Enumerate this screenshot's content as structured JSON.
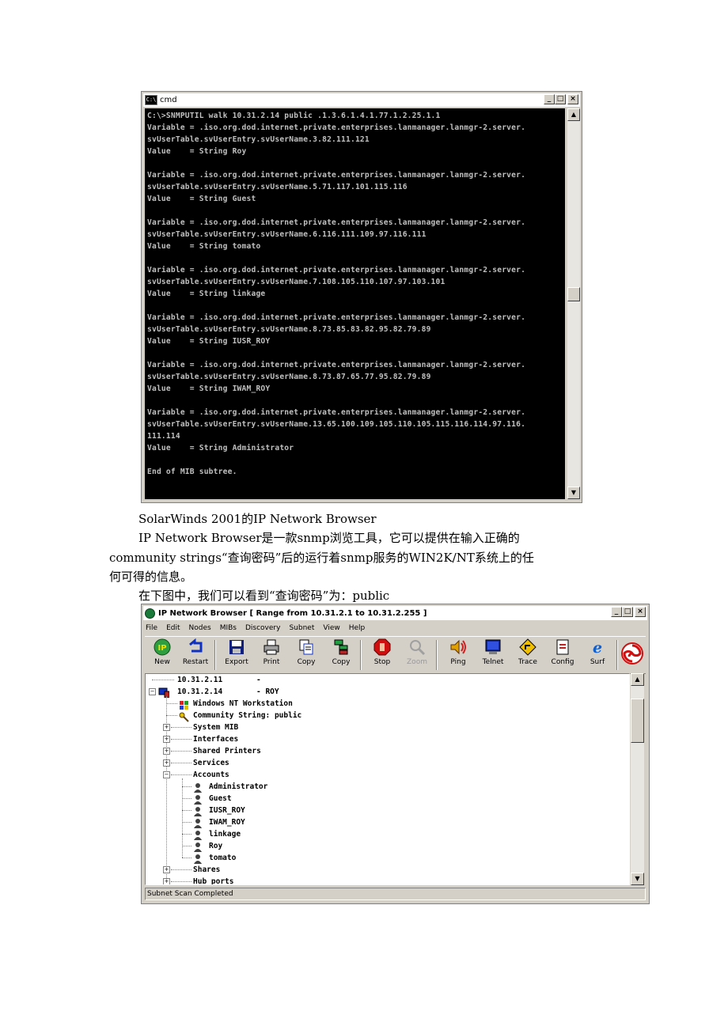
{
  "cmd": {
    "title": "cmd",
    "lines": [
      "C:\\>SNMPUTIL walk 10.31.2.14 public .1.3.6.1.4.1.77.1.2.25.1.1",
      "Variable = .iso.org.dod.internet.private.enterprises.lanmanager.lanmgr-2.server.",
      "svUserTable.svUserEntry.svUserName.3.82.111.121",
      "Value    = String Roy",
      "",
      "Variable = .iso.org.dod.internet.private.enterprises.lanmanager.lanmgr-2.server.",
      "svUserTable.svUserEntry.svUserName.5.71.117.101.115.116",
      "Value    = String Guest",
      "",
      "Variable = .iso.org.dod.internet.private.enterprises.lanmanager.lanmgr-2.server.",
      "svUserTable.svUserEntry.svUserName.6.116.111.109.97.116.111",
      "Value    = String tomato",
      "",
      "Variable = .iso.org.dod.internet.private.enterprises.lanmanager.lanmgr-2.server.",
      "svUserTable.svUserEntry.svUserName.7.108.105.110.107.97.103.101",
      "Value    = String linkage",
      "",
      "Variable = .iso.org.dod.internet.private.enterprises.lanmanager.lanmgr-2.server.",
      "svUserTable.svUserEntry.svUserName.8.73.85.83.82.95.82.79.89",
      "Value    = String IUSR_ROY",
      "",
      "Variable = .iso.org.dod.internet.private.enterprises.lanmanager.lanmgr-2.server.",
      "svUserTable.svUserEntry.svUserName.8.73.87.65.77.95.82.79.89",
      "Value    = String IWAM_ROY",
      "",
      "Variable = .iso.org.dod.internet.private.enterprises.lanmanager.lanmgr-2.server.",
      "svUserTable.svUserEntry.svUserName.13.65.100.109.105.110.105.115.116.114.97.116.",
      "111.114",
      "Value    = String Administrator",
      "",
      "End of MIB subtree."
    ]
  },
  "text": {
    "caption": "SolarWinds 2001的IP Network Browser",
    "para1_line1": "IP Network Browser是一款snmp浏览工具，它可以提供在输入正确的",
    "para1_line2": "community strings“查询密码”后的运行着snmp服务的WIN2K/NT系统上的任",
    "para1_line3": "何可得的信息。",
    "para2": "在下图中，我们可以看到“查询密码”为：public"
  },
  "ipb": {
    "title": "IP Network Browser [ Range from 10.31.2.1 to 10.31.2.255 ]",
    "menu": [
      "File",
      "Edit",
      "Nodes",
      "MIBs",
      "Discovery",
      "Subnet",
      "View",
      "Help"
    ],
    "toolbar": [
      {
        "label": "New",
        "icon": "new-icon"
      },
      {
        "label": "Restart",
        "icon": "restart-icon"
      },
      {
        "label": "Export",
        "icon": "export-icon"
      },
      {
        "label": "Print",
        "icon": "print-icon"
      },
      {
        "label": "Copy",
        "icon": "copy-icon"
      },
      {
        "label": "Copy",
        "icon": "copy-tree-icon"
      },
      {
        "label": "Stop",
        "icon": "stop-icon"
      },
      {
        "label": "Zoom",
        "icon": "zoom-icon"
      },
      {
        "label": "Ping",
        "icon": "ping-icon"
      },
      {
        "label": "Telnet",
        "icon": "telnet-icon"
      },
      {
        "label": "Trace",
        "icon": "trace-icon"
      },
      {
        "label": "Config",
        "icon": "config-icon"
      },
      {
        "label": "Surf",
        "icon": "surf-icon"
      }
    ],
    "tree": {
      "node1_ip": "10.31.2.11",
      "node1_suffix": "-",
      "node2_ip": "10.31.2.14",
      "node2_suffix": "- ROY",
      "os": "Windows NT Workstation",
      "community": "Community String: public",
      "folders": [
        "System MIB",
        "Interfaces",
        "Shared Printers",
        "Services",
        "Accounts"
      ],
      "accounts": [
        "Administrator",
        "Guest",
        "IUSR_ROY",
        "IWAM_ROY",
        "linkage",
        "Roy",
        "tomato"
      ],
      "after": [
        "Shares",
        "Hub ports"
      ]
    },
    "status": "Subnet Scan Completed"
  }
}
